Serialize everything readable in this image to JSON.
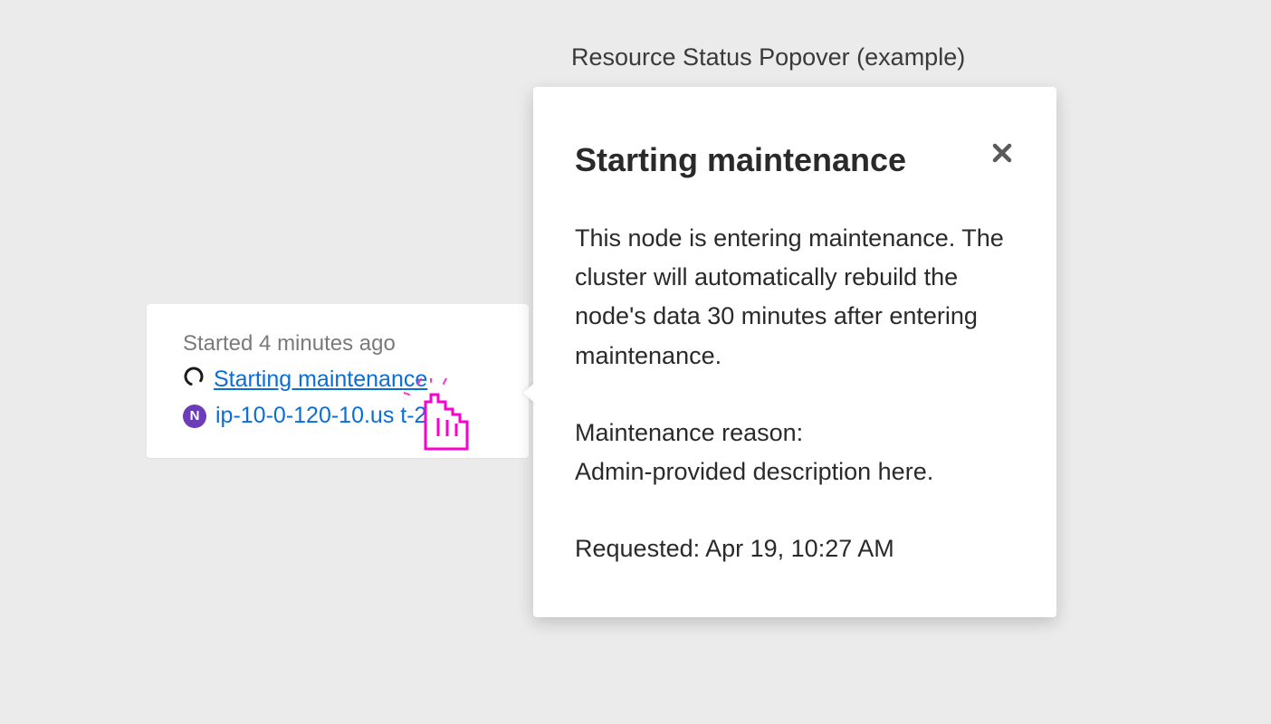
{
  "page": {
    "title": "Resource Status Popover (example)"
  },
  "card": {
    "started": "Started 4 minutes ago",
    "status_link": "Starting maintenance",
    "node_badge_letter": "N",
    "node_link": "ip-10-0-120-10.us    t-2."
  },
  "popover": {
    "title": "Starting maintenance",
    "body1": "This node is entering maintenance. The cluster will automatically rebuild the node's data 30 minutes after entering maintenance.",
    "body2_label": "Maintenance reason:",
    "body2_value": "Admin-provided description here.",
    "body3": "Requested: Apr 19, 10:27 AM"
  }
}
